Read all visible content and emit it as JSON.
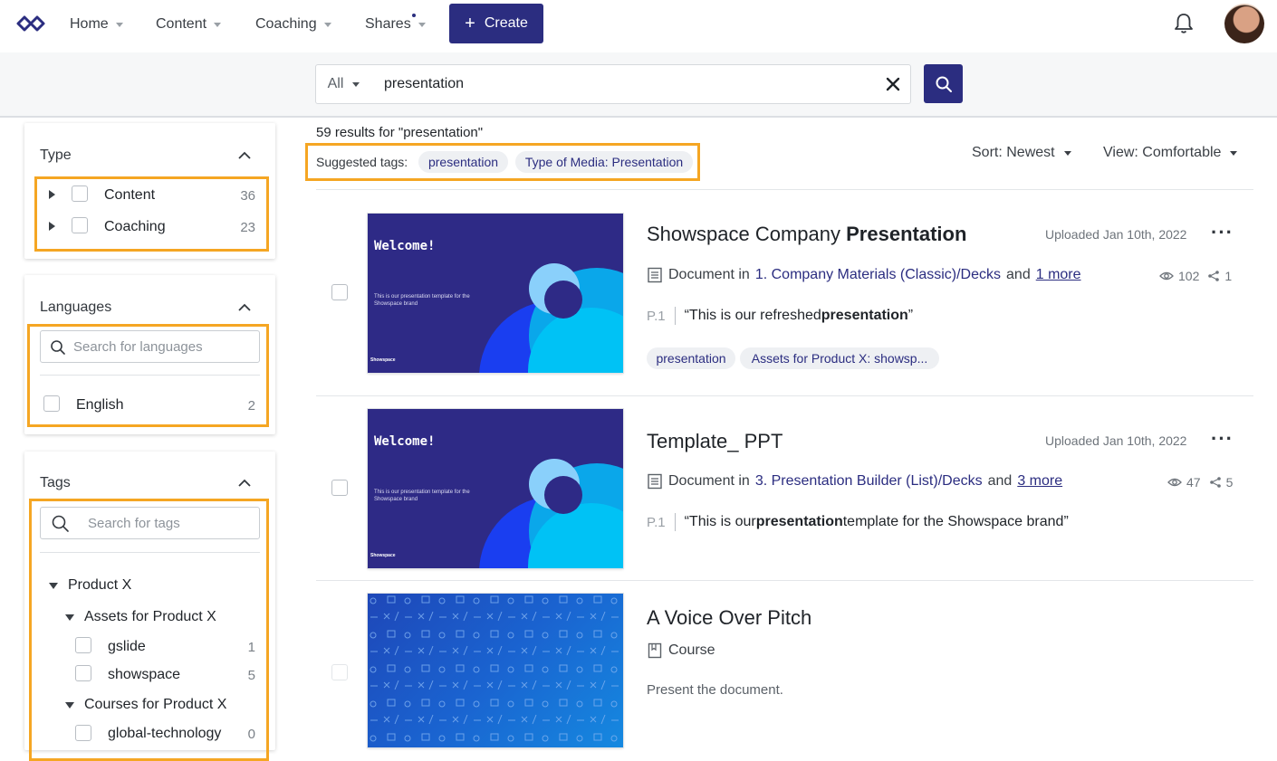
{
  "nav": {
    "items": [
      {
        "label": "Home",
        "has_dot": false
      },
      {
        "label": "Content",
        "has_dot": false
      },
      {
        "label": "Coaching",
        "has_dot": false
      },
      {
        "label": "Shares",
        "has_dot": true
      }
    ],
    "create_label": "Create",
    "accent": "#2b2d80"
  },
  "search": {
    "scope": "All",
    "query": "presentation"
  },
  "filters": {
    "type": {
      "title": "Type",
      "items": [
        {
          "label": "Content",
          "count": "36"
        },
        {
          "label": "Coaching",
          "count": "23"
        }
      ]
    },
    "languages": {
      "title": "Languages",
      "placeholder": "Search for languages",
      "items": [
        {
          "label": "English",
          "count": "2"
        }
      ]
    },
    "tags": {
      "title": "Tags",
      "placeholder": "Search for tags",
      "tree": {
        "root": "Product X",
        "group1": "Assets for Product X",
        "group1_items": [
          {
            "label": "gslide",
            "count": "1"
          },
          {
            "label": "showspace",
            "count": "5"
          }
        ],
        "group2": "Courses for Product X",
        "group2_items": [
          {
            "label": "global-technology",
            "count": "0"
          }
        ]
      }
    },
    "highlight_color": "#f5a623"
  },
  "results": {
    "count_text": "59 results for \"presentation\"",
    "suggested_label": "Suggested tags:",
    "suggested_tags": [
      "presentation",
      "Type of Media: Presentation"
    ],
    "sort_label": "Sort: Newest",
    "view_label": "View: Comfortable",
    "items": [
      {
        "title_plain": "Showspace Company ",
        "title_bold": "Presentation",
        "uploaded": "Uploaded Jan 10th, 2022",
        "doc_type": "Document in",
        "location": "1. Company Materials (Classic)/Decks",
        "and": "and",
        "more": "1 more",
        "views": "102",
        "shares": "1",
        "page": "P.1",
        "snippet_pre": "“This is our refreshed ",
        "snippet_bold": "presentation",
        "snippet_post": "”",
        "tags": [
          "presentation",
          "Assets for Product X: showsp..."
        ],
        "thumb": {
          "headline": "Welcome!",
          "subtitle": "This is our presentation template for the Showspace brand",
          "brand": "Showspace"
        }
      },
      {
        "title_plain": "Template_ PPT",
        "uploaded": "Uploaded Jan 10th, 2022",
        "doc_type": "Document in",
        "location": "3. Presentation Builder (List)/Decks",
        "and": "and",
        "more": "3 more",
        "views": "47",
        "shares": "5",
        "page": "P.1",
        "snippet_pre": "“This is our ",
        "snippet_bold": "presentation",
        "snippet_post": " template for the Showspace brand”",
        "thumb": {
          "headline": "Welcome!",
          "subtitle": "This is our presentation template for the Showspace brand",
          "brand": "Showspace"
        }
      },
      {
        "title_plain": "A Voice Over Pitch",
        "doc_type": "Course",
        "description": "Present the document."
      }
    ]
  }
}
